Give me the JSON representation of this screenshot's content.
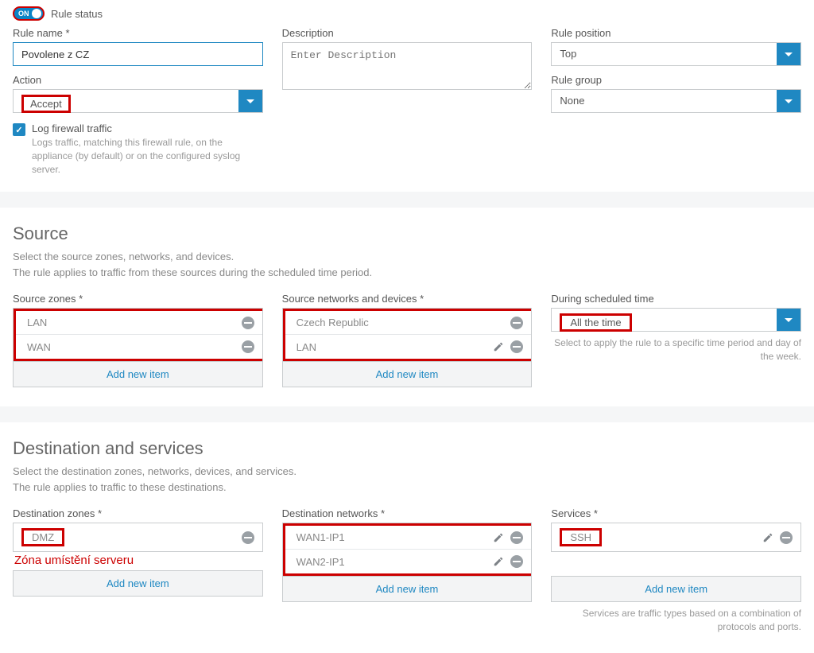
{
  "ruleStatus": {
    "toggleText": "ON",
    "label": "Rule status"
  },
  "ruleName": {
    "label": "Rule name",
    "value": "Povolene z CZ"
  },
  "description": {
    "label": "Description",
    "placeholder": "Enter Description"
  },
  "rulePosition": {
    "label": "Rule position",
    "value": "Top"
  },
  "ruleGroup": {
    "label": "Rule group",
    "value": "None"
  },
  "action": {
    "label": "Action",
    "value": "Accept"
  },
  "logFirewall": {
    "label": "Log firewall traffic",
    "help": "Logs traffic, matching this firewall rule, on the appliance (by default) or on the configured syslog server."
  },
  "source": {
    "title": "Source",
    "sub1": "Select the source zones, networks, and devices.",
    "sub2": "The rule applies to traffic from these sources during the scheduled time period."
  },
  "sourceZones": {
    "label": "Source zones",
    "items": [
      "LAN",
      "WAN"
    ]
  },
  "sourceNetworks": {
    "label": "Source networks and devices",
    "items": [
      "Czech Republic",
      "LAN"
    ]
  },
  "schedule": {
    "label": "During scheduled time",
    "value": "All the time",
    "help": "Select to apply the rule to a specific time period and day of the week."
  },
  "addNewItem": "Add new item",
  "destination": {
    "title": "Destination and services",
    "sub1": "Select the destination zones, networks, devices, and services.",
    "sub2": "The rule applies to traffic to these destinations."
  },
  "destZones": {
    "label": "Destination zones",
    "items": [
      "DMZ"
    ],
    "note": "Zóna umístění serveru"
  },
  "destNetworks": {
    "label": "Destination networks",
    "items": [
      "WAN1-IP1",
      "WAN2-IP1"
    ]
  },
  "services": {
    "label": "Services",
    "items": [
      "SSH"
    ],
    "help": "Services are traffic types based on a combination of protocols and ports."
  }
}
